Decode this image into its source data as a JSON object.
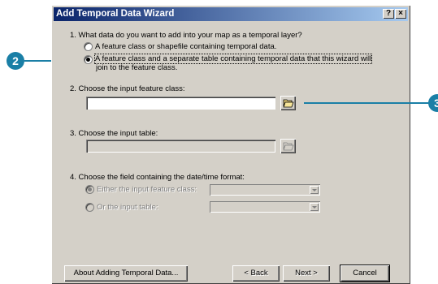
{
  "window": {
    "title": "Add Temporal Data Wizard",
    "help_btn": "?",
    "close_btn": "×"
  },
  "q1": {
    "label": "1.  What data do you want to add into your map as a temporal layer?",
    "option_a": "A feature class or shapefile containing temporal data.",
    "option_b_line1": "A feature class and a separate table containing temporal data that this wizard will",
    "option_b_line2": "join to the feature class."
  },
  "q2": {
    "label": "2.  Choose the input feature class:",
    "value": ""
  },
  "q3": {
    "label": "3.  Choose the input table:",
    "value": ""
  },
  "q4": {
    "label": "4.  Choose the field containing the date/time format:",
    "opt1": "Either the input feature class:",
    "opt2": "Or the input table:"
  },
  "buttons": {
    "about": "About Adding Temporal Data...",
    "back": "< Back",
    "next": "Next >",
    "cancel": "Cancel"
  },
  "callouts": {
    "c2": "2",
    "c3": "3"
  },
  "icons": {
    "browse": "open-folder-icon"
  },
  "colors": {
    "title_start": "#0a246a",
    "title_end": "#a6caf0",
    "callout": "#1a7fa6"
  }
}
